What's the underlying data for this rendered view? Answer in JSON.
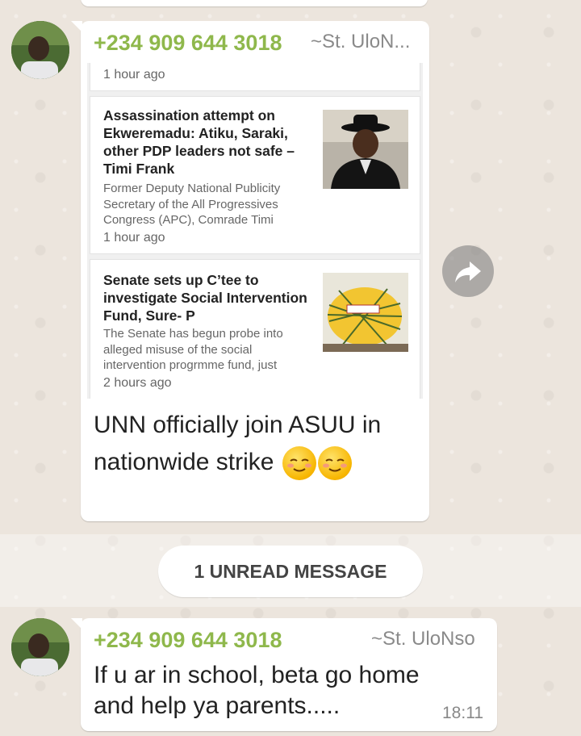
{
  "messages": [
    {
      "sender_phone": "+234 909 644 3018",
      "sender_name": "~St. UloN...",
      "news_items": [
        {
          "time": "1 hour ago"
        },
        {
          "title": "Assassination attempt on Ekweremadu: Atiku, Saraki, other PDP leaders not safe – Timi Frank",
          "desc": "Former Deputy National Publicity Secretary of the All Progressives Congress (APC), Comrade Timi",
          "time": "1 hour ago",
          "thumb": "man-in-black-hat"
        },
        {
          "title": "Senate sets up C’tee to investigate Social Intervention Fund, Sure- P",
          "desc": "The Senate has begun probe into alleged misuse of the social intervention progrmme fund, just",
          "time": "2 hours ago",
          "thumb": "probe-cartoon"
        }
      ],
      "text": "UNN  officially join ASUU in nationwide strike",
      "emojis": [
        "relieved-face",
        "relieved-face"
      ]
    },
    {
      "sender_phone": "+234 909 644 3018",
      "sender_name": "~St. UloNso",
      "text": "If u ar in school, beta go home and help ya parents.....",
      "time": "18:11"
    }
  ],
  "unread_divider": "1 UNREAD MESSAGE",
  "icons": {
    "forward": "forward-arrow-icon"
  },
  "colors": {
    "sender": "#8fb84c",
    "background": "#ece5dd"
  }
}
